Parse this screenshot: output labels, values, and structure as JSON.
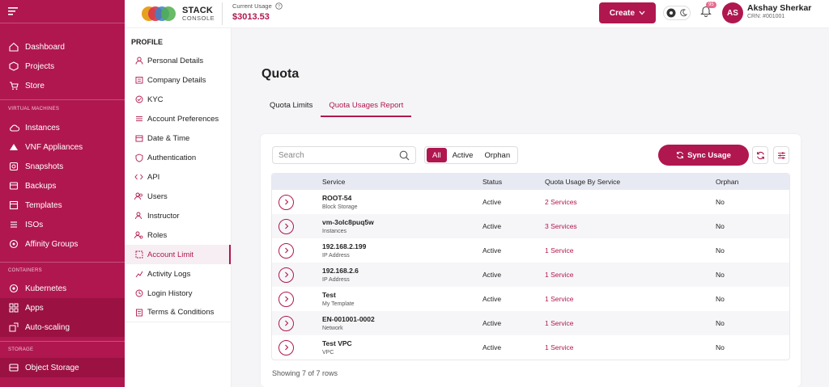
{
  "sidebar": {
    "items": [
      {
        "label": "Dashboard",
        "icon": "dashboard-icon"
      },
      {
        "label": "Projects",
        "icon": "projects-icon"
      },
      {
        "label": "Store",
        "icon": "cart-icon"
      }
    ],
    "section_vm": "VIRTUAL MACHINES",
    "vm_items": [
      {
        "label": "Instances",
        "icon": "cloud-icon"
      },
      {
        "label": "VNF Appliances",
        "icon": "vnf-icon"
      },
      {
        "label": "Snapshots",
        "icon": "snapshot-icon"
      },
      {
        "label": "Backups",
        "icon": "backup-icon"
      },
      {
        "label": "Templates",
        "icon": "template-icon"
      },
      {
        "label": "ISOs",
        "icon": "iso-icon"
      },
      {
        "label": "Affinity Groups",
        "icon": "affinity-icon"
      }
    ],
    "section_containers": "CONTAINERS",
    "container_items": [
      {
        "label": "Kubernetes",
        "icon": "kubernetes-icon"
      },
      {
        "label": "Apps",
        "icon": "apps-icon"
      },
      {
        "label": "Auto-scaling",
        "icon": "autoscale-icon"
      }
    ],
    "section_storage": "STORAGE",
    "storage_items": [
      {
        "label": "Object Storage",
        "icon": "storage-icon"
      }
    ]
  },
  "topbar": {
    "logo_line1": "STACK",
    "logo_line2": "CONSOLE",
    "usage_label": "Current Usage",
    "usage_value": "$3013.53",
    "create_label": "Create",
    "notification_count": "95",
    "avatar_initials": "AS",
    "user_name": "Akshay Sherkar",
    "user_crn": "CRN: #001001"
  },
  "profile": {
    "heading": "PROFILE",
    "items": [
      {
        "label": "Personal Details",
        "icon": "user-icon"
      },
      {
        "label": "Company Details",
        "icon": "company-icon"
      },
      {
        "label": "KYC",
        "icon": "kyc-icon"
      },
      {
        "label": "Account Preferences",
        "icon": "preferences-icon"
      },
      {
        "label": "Date & Time",
        "icon": "calendar-icon"
      },
      {
        "label": "Authentication",
        "icon": "shield-icon"
      },
      {
        "label": "API",
        "icon": "code-icon"
      },
      {
        "label": "Users",
        "icon": "users-icon"
      },
      {
        "label": "Instructor",
        "icon": "instructor-icon"
      },
      {
        "label": "Roles",
        "icon": "roles-icon"
      },
      {
        "label": "Account Limit",
        "icon": "limit-icon"
      },
      {
        "label": "Activity Logs",
        "icon": "activity-icon"
      },
      {
        "label": "Login History",
        "icon": "history-icon"
      },
      {
        "label": "Terms & Conditions",
        "icon": "terms-icon"
      }
    ]
  },
  "main": {
    "title": "Quota",
    "tabs": [
      {
        "label": "Quota Limits"
      },
      {
        "label": "Quota Usages Report"
      }
    ],
    "search_placeholder": "Search",
    "filters": [
      {
        "label": "All"
      },
      {
        "label": "Active"
      },
      {
        "label": "Orphan"
      }
    ],
    "sync_label": "Sync Usage",
    "columns": [
      "Service",
      "Status",
      "Quota Usage By Service",
      "Orphan"
    ],
    "rows": [
      {
        "name": "ROOT-54",
        "type": "Block Storage",
        "status": "Active",
        "usage": "2 Services",
        "orphan": "No"
      },
      {
        "name": "vm-3olc8puq5w",
        "type": "Instances",
        "status": "Active",
        "usage": "3 Services",
        "orphan": "No"
      },
      {
        "name": "192.168.2.199",
        "type": "IP Address",
        "status": "Active",
        "usage": "1 Service",
        "orphan": "No"
      },
      {
        "name": "192.168.2.6",
        "type": "IP Address",
        "status": "Active",
        "usage": "1 Service",
        "orphan": "No"
      },
      {
        "name": "Test",
        "type": "My Template",
        "status": "Active",
        "usage": "1 Service",
        "orphan": "No"
      },
      {
        "name": "EN-001001-0002",
        "type": "Network",
        "status": "Active",
        "usage": "1 Service",
        "orphan": "No"
      },
      {
        "name": "Test VPC",
        "type": "VPC",
        "status": "Active",
        "usage": "1 Service",
        "orphan": "No"
      }
    ],
    "showing": "Showing 7 of 7 rows"
  }
}
